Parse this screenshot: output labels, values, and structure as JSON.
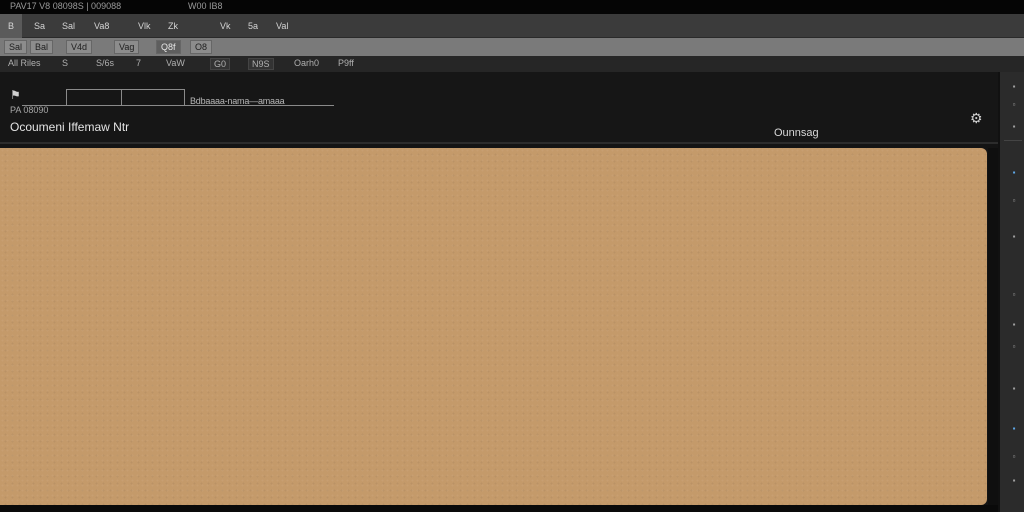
{
  "titlebar": {
    "left_text": "PAV17 V8  08098S  |  009088",
    "center_text": "W00  IB8"
  },
  "menubar": {
    "items": [
      "B",
      "Sa",
      "Sal",
      "Va8",
      "Vlk",
      "Zk",
      "Vk",
      "5a",
      "Val"
    ]
  },
  "toolbar": {
    "items": [
      "Sal",
      "Bal",
      "V4d",
      "Vag",
      "Q8f",
      "O8"
    ]
  },
  "optionsbar": {
    "items": [
      "All Riles",
      "S",
      "S/6s",
      "7",
      "VaW",
      "G0",
      "N9S",
      "Oarh0",
      "P9ff"
    ]
  },
  "panel": {
    "small_label": "PA  08090",
    "ruler_text": "Bdbaaaa-nama—amaaa",
    "doc_title": "Ocoumeni Iffemaw Ntr",
    "status_label": "Ounnsag"
  },
  "colors": {
    "canvas": "#c49a6a",
    "background": "#141414",
    "menubar": "#3b3b3b",
    "toolbar": "#7a7a7a",
    "accent": "#5fa8e8"
  },
  "icons": {
    "ruler": "flag-icon",
    "settings": "gear-icon"
  }
}
